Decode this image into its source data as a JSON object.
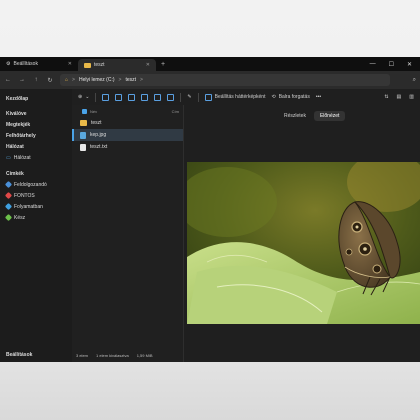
{
  "tabs": [
    {
      "label": "Beállítások",
      "icon": "gear-icon",
      "close": "✕"
    },
    {
      "label": "teszt",
      "icon": "folder-icon",
      "close": "✕"
    }
  ],
  "tab_add": "+",
  "address": {
    "drive": "Helyi lemez (C:)",
    "folder": "teszt",
    "sep": ">",
    "chevron": "⌄"
  },
  "toolbar": {
    "new_label": "Új",
    "set_background_label": "Beállítás háttérképként",
    "rotate_right_label": "Balra forgatás",
    "more": "•••"
  },
  "sidebar": {
    "pinned": [
      "Kezdőlap"
    ],
    "top": [
      "Kiválóve",
      "Megtekjék",
      "Felhőtárhely",
      "Hálózat"
    ],
    "network_sub": "Hálózat",
    "tags_heading": "Címkék",
    "tags": [
      {
        "label": "Feldolgozandó",
        "color": "#4a90d9"
      },
      {
        "label": "FONTOS",
        "color": "#e04848"
      },
      {
        "label": "Folyamatban",
        "color": "#3fa0e0"
      },
      {
        "label": "Kész",
        "color": "#6cc04a"
      }
    ],
    "bottom": "Beállítások"
  },
  "files": {
    "header_name": "Név",
    "header_col2": "Cím",
    "items": [
      {
        "name": "teszt",
        "type": "folder"
      },
      {
        "name": "kep.jpg",
        "type": "image",
        "selected": true
      },
      {
        "name": "teszt.txt",
        "type": "text"
      }
    ]
  },
  "status": {
    "count": "3 elem",
    "selected": "1 elem kiválasztva",
    "size": "1,59 MiB"
  },
  "preview": {
    "tab_details": "Részletek",
    "tab_preview": "Előnézet"
  }
}
